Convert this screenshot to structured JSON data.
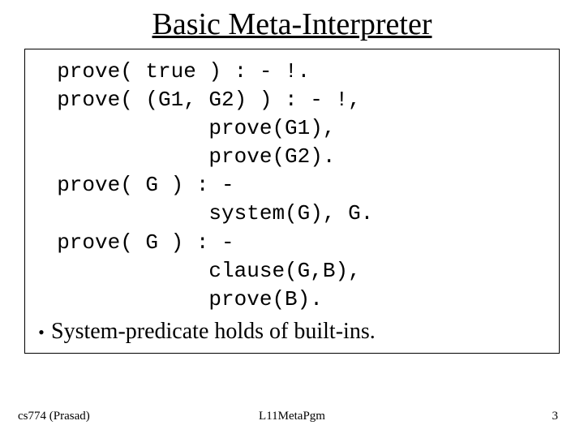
{
  "title": "Basic Meta-Interpreter",
  "code": {
    "l1": "  prove( true ) : - !.",
    "l2": "  prove( (G1, G2) ) : - !,",
    "l3": "              prove(G1),",
    "l4": "              prove(G2).",
    "l5": "  prove( G ) : -",
    "l6": "              system(G), G.",
    "l7": "  prove( G ) : -",
    "l8": "              clause(G,B),",
    "l9": "              prove(B)."
  },
  "bullet": {
    "marker": "•",
    "text": "System-predicate holds of built-ins."
  },
  "footer": {
    "left": "cs774 (Prasad)",
    "center": "L11MetaPgm",
    "right": "3"
  }
}
